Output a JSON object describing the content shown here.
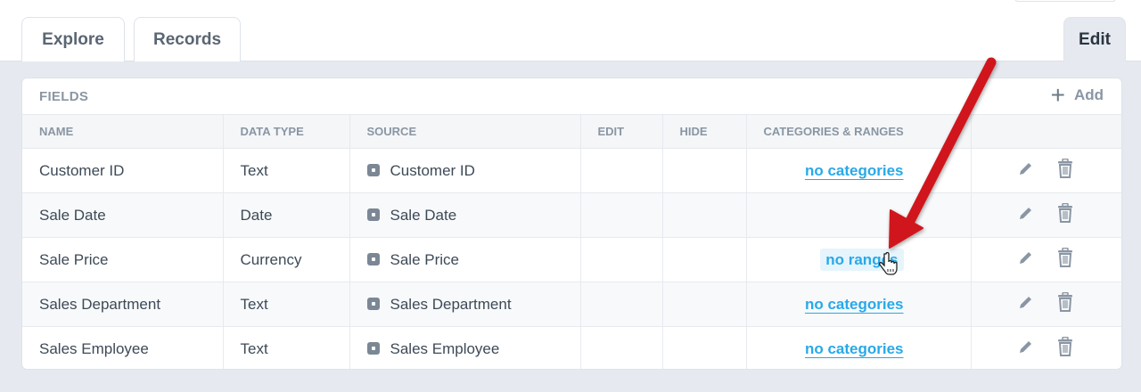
{
  "tabs": [
    {
      "label": "Explore"
    },
    {
      "label": "Records"
    },
    {
      "label": "Edit",
      "active": true
    }
  ],
  "fields": {
    "title": "FIELDS",
    "add_label": "Add",
    "columns": [
      "NAME",
      "DATA TYPE",
      "SOURCE",
      "EDIT",
      "HIDE",
      "CATEGORIES & RANGES",
      ""
    ],
    "rows": [
      {
        "name": "Customer ID",
        "type": "Text",
        "source": "Customer ID",
        "categories": "no categories"
      },
      {
        "name": "Sale Date",
        "type": "Date",
        "source": "Sale Date",
        "categories": ""
      },
      {
        "name": "Sale Price",
        "type": "Currency",
        "source": "Sale Price",
        "categories": "no ranges"
      },
      {
        "name": "Sales Department",
        "type": "Text",
        "source": "Sales Department",
        "categories": "no categories"
      },
      {
        "name": "Sales Employee",
        "type": "Text",
        "source": "Sales Employee",
        "categories": "no categories"
      }
    ]
  },
  "colors": {
    "accent": "#28a9e8",
    "arrow": "#d0171b"
  }
}
